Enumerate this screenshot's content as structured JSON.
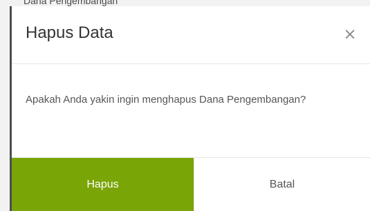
{
  "backdrop": {
    "partial_text": "Dana Pengembangan"
  },
  "modal": {
    "title": "Hapus Data",
    "close_symbol": "×",
    "body_text": "Apakah Anda yakin ingin menghapus Dana Pengembangan?",
    "confirm_label": "Hapus",
    "cancel_label": "Batal"
  },
  "colors": {
    "confirm_bg": "#7aa506",
    "confirm_text": "#ffffff",
    "cancel_bg": "#ffffff",
    "cancel_text": "#555555"
  }
}
